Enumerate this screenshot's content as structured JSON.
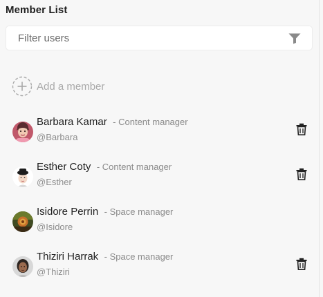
{
  "panel": {
    "title": "Member List"
  },
  "search": {
    "placeholder": "Filter users",
    "value": ""
  },
  "add_member": {
    "label": "Add a member"
  },
  "members": [
    {
      "name": "Barbara Kamar",
      "role": "- Content manager",
      "handle": "@Barbara",
      "has_delete": true
    },
    {
      "name": "Esther Coty",
      "role": "- Content manager",
      "handle": "@Esther",
      "has_delete": true
    },
    {
      "name": "Isidore Perrin",
      "role": "- Space manager",
      "handle": "@Isidore",
      "has_delete": false
    },
    {
      "name": "Thiziri Harrak",
      "role": "- Space manager",
      "handle": "@Thiziri",
      "has_delete": true
    }
  ],
  "icons": {
    "filter": "filter-icon",
    "add": "add-member-icon",
    "delete": "trash-icon"
  },
  "colors": {
    "background": "#f7f7f7",
    "text": "#1f1f1f",
    "muted": "#8a8a8a",
    "placeholder": "#a9a9a9"
  }
}
